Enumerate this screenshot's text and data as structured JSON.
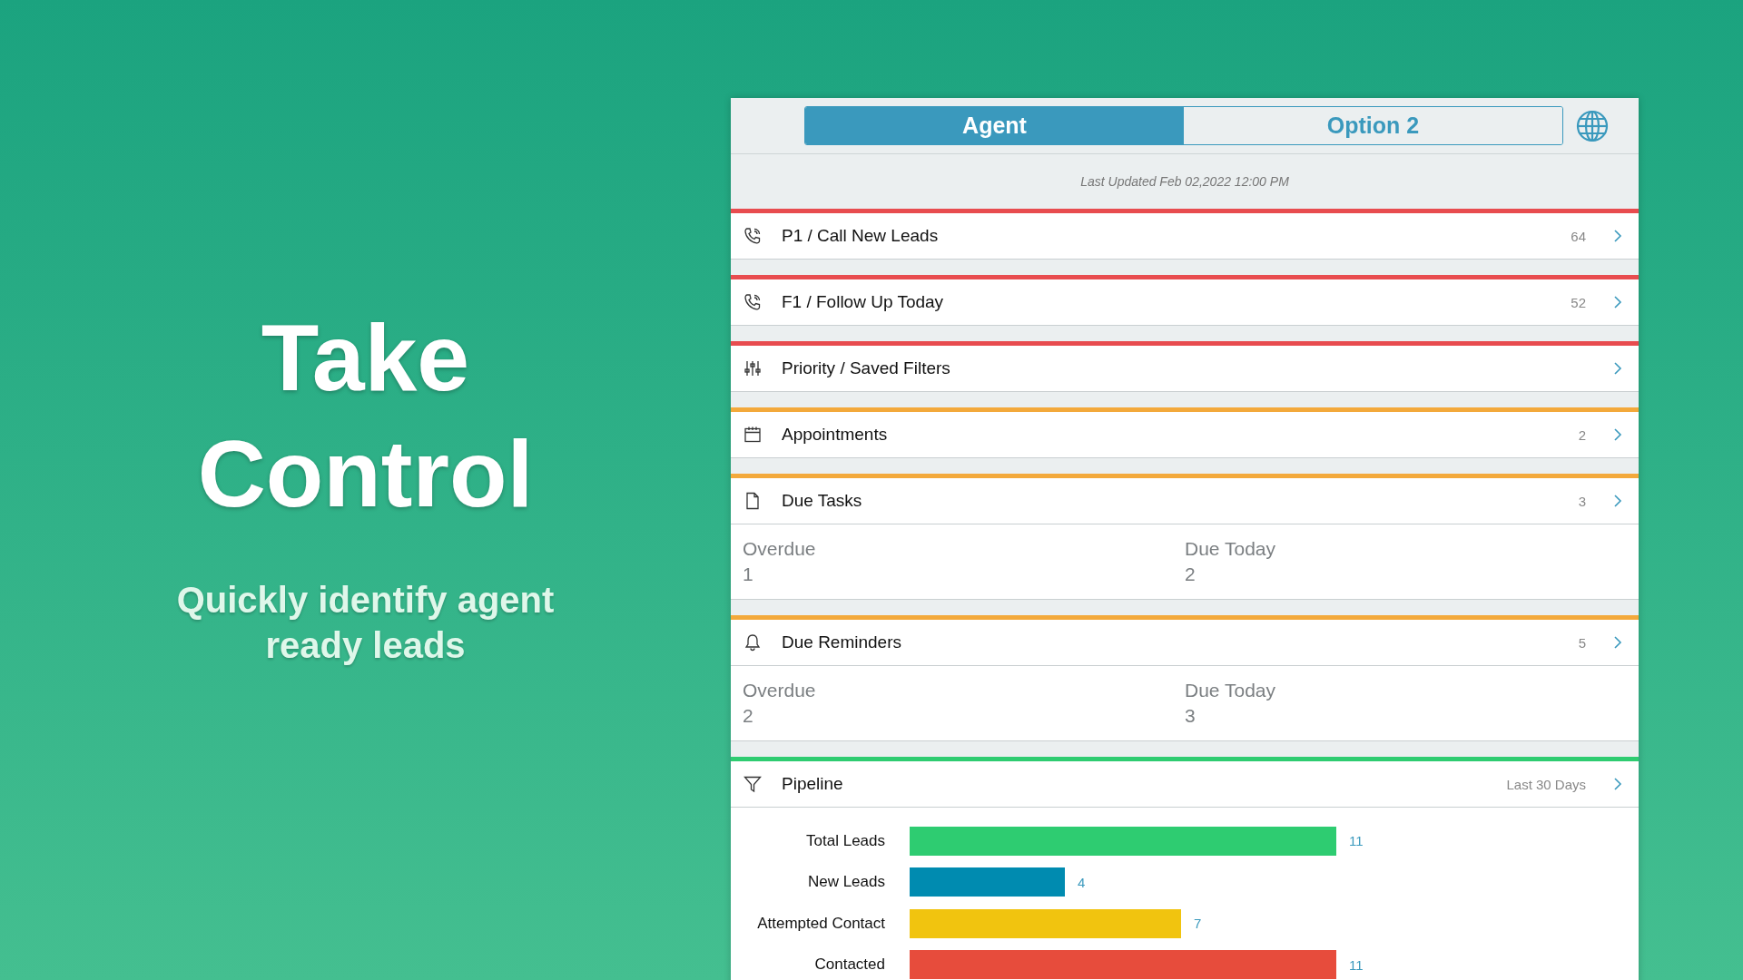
{
  "hero": {
    "title_lines": [
      "Take",
      "Control"
    ],
    "subtitle": "Quickly identify agent ready leads"
  },
  "tabs": [
    {
      "label": "Agent",
      "selected": true
    },
    {
      "label": "Option 2",
      "selected": false
    }
  ],
  "last_updated": "Last Updated Feb 02,2022 12:00 PM",
  "sections": [
    {
      "kind": "phone",
      "label": "P1 / Call New Leads",
      "count": "64",
      "color": "#e84c4f"
    },
    {
      "kind": "phone",
      "label": "F1 / Follow Up Today",
      "count": "52",
      "color": "#e84c4f"
    },
    {
      "kind": "sliders",
      "label": "Priority / Saved Filters",
      "color": "#e84c4f"
    },
    {
      "kind": "calendar",
      "label": "Appointments",
      "count": "2",
      "color": "#f3a93b"
    },
    {
      "kind": "document",
      "label": "Due Tasks",
      "count": "3",
      "color": "#f3a93b",
      "details": [
        {
          "label": "Overdue",
          "value": "1"
        },
        {
          "label": "Due Today",
          "value": "2"
        }
      ]
    },
    {
      "kind": "bell",
      "label": "Due Reminders",
      "count": "5",
      "color": "#f3a93b",
      "details": [
        {
          "label": "Overdue",
          "value": "2"
        },
        {
          "label": "Due Today",
          "value": "3"
        }
      ]
    },
    {
      "kind": "funnel",
      "label": "Pipeline",
      "note": "Last 30 Days",
      "color": "#2ecc71",
      "chart_data": {
        "type": "bar",
        "orientation": "horizontal",
        "categories": [
          "Total Leads",
          "New Leads",
          "Attempted Contact",
          "Contacted"
        ],
        "series": [
          {
            "values": [
              11,
              4,
              7,
              11
            ]
          }
        ],
        "colors": [
          "#2ecc71",
          "#008bb0",
          "#f1c40f",
          "#e74c3c"
        ],
        "data_labels": true
      }
    }
  ]
}
